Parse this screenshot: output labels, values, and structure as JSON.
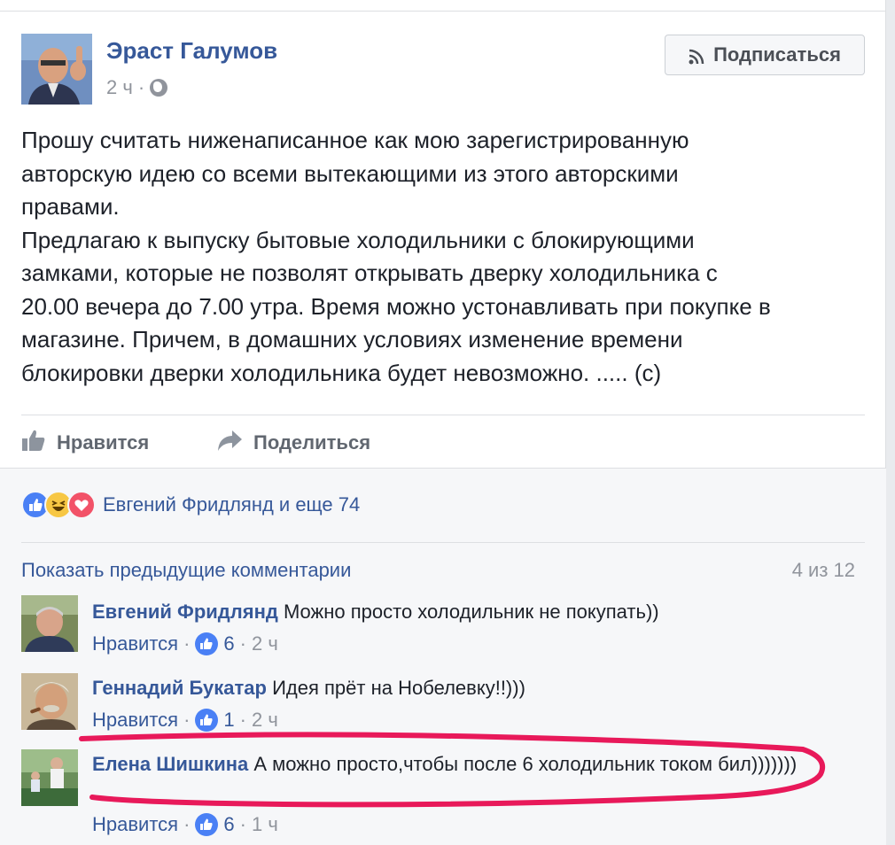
{
  "post": {
    "author": "Эраст Галумов",
    "time": "2 ч",
    "dot": "·",
    "follow_label": "Подписаться",
    "text": "Прошу считать ниженаписанное как мою зарегистрированную\nавторскую идею со всеми вытекающими из этого авторскими\nправами.\nПредлагаю к выпуску бытовые холодильники с блокирующими\nзамками, которые не позволят открывать дверку холодильника с\n20.00 вечера до 7.00 утра. Время можно устонавливать при покупке в\nмагазине. Причем, в домашних условиях изменение времени\nблокировки дверки холодильника будет невозможно. ..... (с)"
  },
  "actions": {
    "like_label": "Нравится",
    "share_label": "Поделиться"
  },
  "reactions": {
    "text": "Евгений Фридлянд и еще 74",
    "icons": [
      "like-icon",
      "haha-icon",
      "love-icon"
    ]
  },
  "comments_header": {
    "show_previous": "Показать предыдущие комментарии",
    "count": "4 из 12"
  },
  "comments": [
    {
      "name": "Евгений Фридлянд",
      "text": "Можно просто холодильник не покупать))",
      "like": "Нравится",
      "likes": "6",
      "time": "2 ч",
      "dot": "·"
    },
    {
      "name": "Геннадий Букатар",
      "text": "Идея прёт на Нобелевку!!)))",
      "like": "Нравится",
      "likes": "1",
      "time": "2 ч",
      "dot": "·"
    },
    {
      "name": "Елена Шишкина",
      "text": "А можно просто,чтобы после 6 холодильник током бил)))))))",
      "like": "Нравится",
      "likes": "6",
      "time": "1 ч",
      "dot": "·"
    }
  ],
  "colors": {
    "link": "#365899",
    "muted": "#90949c",
    "annotation": "#e8195a"
  }
}
